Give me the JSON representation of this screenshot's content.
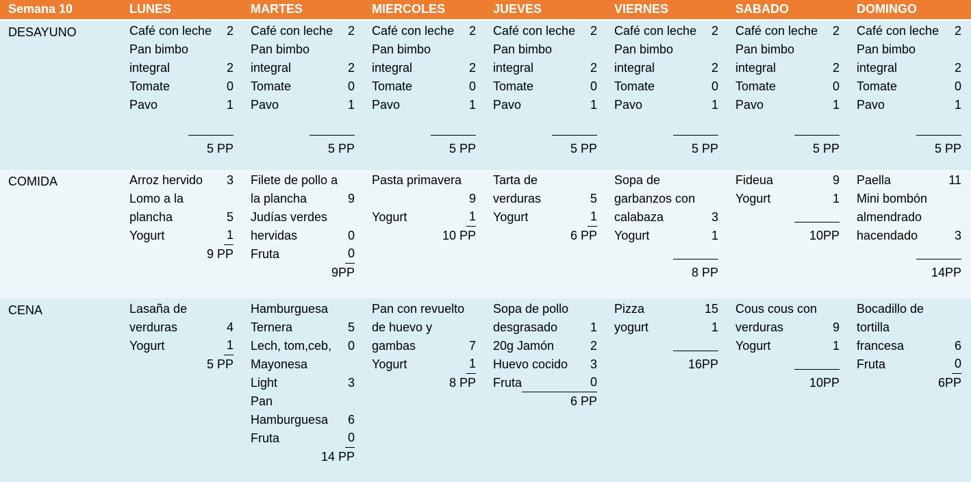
{
  "header": {
    "week": "Semana 10",
    "days": [
      "LUNES",
      "MARTES",
      "MIERCOLES",
      "JUEVES",
      "VIERNES",
      "SABADO",
      "DOMINGO"
    ]
  },
  "colors": {
    "header_bg": "#ED7D31",
    "row_dark": "#DAEEF3",
    "row_light": "#EDF6F9"
  },
  "rows": [
    {
      "meal": "DESAYUNO",
      "days": [
        {
          "items": [
            [
              "Café con leche",
              "2"
            ],
            [
              "Pan bimbo",
              ""
            ],
            [
              "integral",
              "2"
            ],
            [
              "Tomate",
              "0"
            ],
            [
              "Pavo",
              "1"
            ]
          ],
          "rule": true,
          "total": "5 PP"
        },
        {
          "items": [
            [
              "Café con leche",
              "2"
            ],
            [
              "Pan bimbo",
              ""
            ],
            [
              "integral",
              "2"
            ],
            [
              "Tomate",
              "0"
            ],
            [
              "Pavo",
              "1"
            ]
          ],
          "rule": true,
          "total": "5 PP"
        },
        {
          "items": [
            [
              "Café con leche",
              "2"
            ],
            [
              "Pan bimbo",
              ""
            ],
            [
              "integral",
              "2"
            ],
            [
              "Tomate",
              "0"
            ],
            [
              "Pavo",
              "1"
            ]
          ],
          "rule": true,
          "total": "5 PP"
        },
        {
          "items": [
            [
              "Café con leche",
              "2"
            ],
            [
              "Pan bimbo",
              ""
            ],
            [
              "integral",
              "2"
            ],
            [
              "Tomate",
              "0"
            ],
            [
              "Pavo",
              "1"
            ]
          ],
          "rule": true,
          "total": "5 PP"
        },
        {
          "items": [
            [
              "Café con leche",
              "2"
            ],
            [
              "Pan bimbo",
              ""
            ],
            [
              "integral",
              "2"
            ],
            [
              "Tomate",
              "0"
            ],
            [
              "Pavo",
              "1"
            ]
          ],
          "rule": true,
          "total": "5 PP"
        },
        {
          "items": [
            [
              "Café con leche",
              "2"
            ],
            [
              "Pan bimbo",
              ""
            ],
            [
              "integral",
              "2"
            ],
            [
              "Tomate",
              "0"
            ],
            [
              "Pavo",
              "1"
            ]
          ],
          "rule": true,
          "total": "5 PP"
        },
        {
          "items": [
            [
              "Café con leche",
              "2"
            ],
            [
              "Pan bimbo",
              ""
            ],
            [
              "integral",
              "2"
            ],
            [
              "Tomate",
              "0"
            ],
            [
              "Pavo",
              "1"
            ]
          ],
          "rule": true,
          "total": "5 PP"
        }
      ]
    },
    {
      "meal": "COMIDA",
      "days": [
        {
          "items": [
            [
              "Arroz hervido",
              "3"
            ],
            [
              "Lomo a la",
              ""
            ],
            [
              "plancha",
              "5"
            ],
            [
              "Yogurt",
              "1"
            ]
          ],
          "ul_last": true,
          "total": "9 PP"
        },
        {
          "items": [
            [
              "Filete de pollo a",
              ""
            ],
            [
              "la plancha",
              "9"
            ],
            [
              "Judías verdes",
              ""
            ],
            [
              "hervidas",
              "0"
            ],
            [
              "Fruta",
              "0"
            ]
          ],
          "ul_last": true,
          "total": "9PP"
        },
        {
          "items": [
            [
              " Pasta primavera",
              ""
            ],
            [
              "",
              "9"
            ],
            [
              "Yogurt",
              "1"
            ]
          ],
          "ul_last": true,
          "total": "10 PP"
        },
        {
          "items": [
            [
              "Tarta de",
              ""
            ],
            [
              "verduras",
              "5"
            ],
            [
              "Yogurt",
              "1"
            ]
          ],
          "ul_last": true,
          "total": "6 PP"
        },
        {
          "items": [
            [
              "Sopa de",
              ""
            ],
            [
              "garbanzos con",
              ""
            ],
            [
              "calabaza",
              "3"
            ],
            [
              "Yogurt",
              "1"
            ]
          ],
          "rule": true,
          "total": "8 PP"
        },
        {
          "items": [
            [
              "Fideua",
              "9"
            ],
            [
              "Yogurt",
              "1"
            ]
          ],
          "rule": true,
          "total": "10PP"
        },
        {
          "items": [
            [
              "Paella",
              "11"
            ],
            [
              "Mini bombón",
              ""
            ],
            [
              "almendrado",
              ""
            ],
            [
              "hacendado",
              "3"
            ]
          ],
          "rule": true,
          "total": "14PP"
        }
      ]
    },
    {
      "meal": "CENA",
      "days": [
        {
          "items": [
            [
              "Lasaña de",
              ""
            ],
            [
              "verduras",
              "4"
            ],
            [
              "Yogurt",
              "1"
            ]
          ],
          "ul_last": true,
          "total": "5 PP"
        },
        {
          "items": [
            [
              "Hamburguesa",
              ""
            ],
            [
              "Ternera",
              "5"
            ],
            [
              "Lech, tom,ceb,",
              "0"
            ],
            [
              "Mayonesa",
              ""
            ],
            [
              "Light",
              "3"
            ],
            [
              "Pan",
              ""
            ],
            [
              "Hamburguesa",
              "6"
            ],
            [
              "Fruta",
              "0"
            ]
          ],
          "ul_last": true,
          "total": "14 PP"
        },
        {
          "items": [
            [
              "Pan con revuelto",
              ""
            ],
            [
              "de huevo y",
              ""
            ],
            [
              "gambas",
              "7"
            ],
            [
              "Yogurt",
              "1"
            ]
          ],
          "ul_last": true,
          "total": "8 PP"
        },
        {
          "items": [
            [
              "Sopa de pollo",
              ""
            ],
            [
              "desgrasado",
              "1"
            ],
            [
              "20g Jamón",
              "2"
            ],
            [
              "Huevo cocido",
              "3"
            ],
            [
              "Fruta",
              "0"
            ]
          ],
          "ul_last_wide": true,
          "total": "6 PP"
        },
        {
          "items": [
            [
              "Pizza",
              "15"
            ],
            [
              "yogurt",
              "1"
            ]
          ],
          "rule": true,
          "total": "16PP"
        },
        {
          "items": [
            [
              "Cous cous con",
              ""
            ],
            [
              "verduras",
              "9"
            ],
            [
              "Yogurt",
              "1"
            ]
          ],
          "rule": true,
          "total": "10PP"
        },
        {
          "items": [
            [
              "Bocadillo de",
              ""
            ],
            [
              "tortilla",
              ""
            ],
            [
              "francesa",
              "6"
            ],
            [
              "Fruta",
              "0"
            ]
          ],
          "ul_last": true,
          "total": "6PP"
        }
      ]
    }
  ]
}
